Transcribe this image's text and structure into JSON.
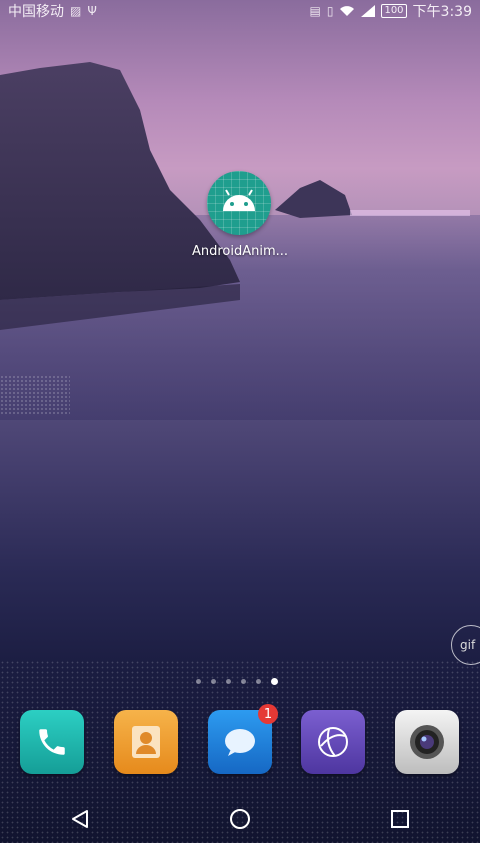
{
  "status_bar": {
    "carrier": "中国移动",
    "time": "下午3:39",
    "battery": "100",
    "icons": [
      "image-icon",
      "usb-icon",
      "nfc-icon",
      "vibrate-icon",
      "wifi-icon",
      "signal-icon",
      "battery-icon"
    ]
  },
  "desktop": {
    "app": {
      "label": "AndroidAnim...",
      "icon": "android-icon",
      "color": "#1f9e8e"
    },
    "gif_button": {
      "label": "gif"
    }
  },
  "page_indicator": {
    "count": 6,
    "active_index": 5
  },
  "dock": {
    "items": [
      {
        "name": "phone",
        "icon": "phone-icon",
        "color": "#1fb7b0"
      },
      {
        "name": "contacts",
        "icon": "contacts-icon",
        "color": "#f0a030"
      },
      {
        "name": "messages",
        "icon": "message-icon",
        "color": "#1e88e5",
        "badge": "1"
      },
      {
        "name": "browser",
        "icon": "globe-icon",
        "color": "#6a4fb8"
      },
      {
        "name": "camera",
        "icon": "camera-icon",
        "color": "#d9d9d9"
      }
    ]
  },
  "nav": {
    "back": "back-icon",
    "home": "home-icon",
    "recents": "recents-icon"
  }
}
